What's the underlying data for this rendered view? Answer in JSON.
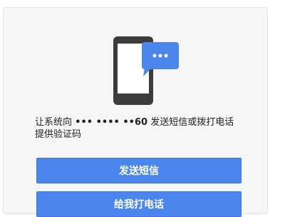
{
  "message": {
    "prefix": "让系统向",
    "masked_number": "••• •••• ••60",
    "suffix_line1": "发送短信或拨打电话",
    "line2": "提供验证码"
  },
  "buttons": {
    "send_sms": "发送短信",
    "call_me": "给我打电话"
  },
  "colors": {
    "primary_button": "#4a86ec",
    "phone_body": "#3c3c3c",
    "chat_bubble": "#4a86ec",
    "card_background": "#f6f6f6"
  },
  "icons": {
    "illustration": "phone-message-icon",
    "bubble": "chat-bubble-icon"
  }
}
